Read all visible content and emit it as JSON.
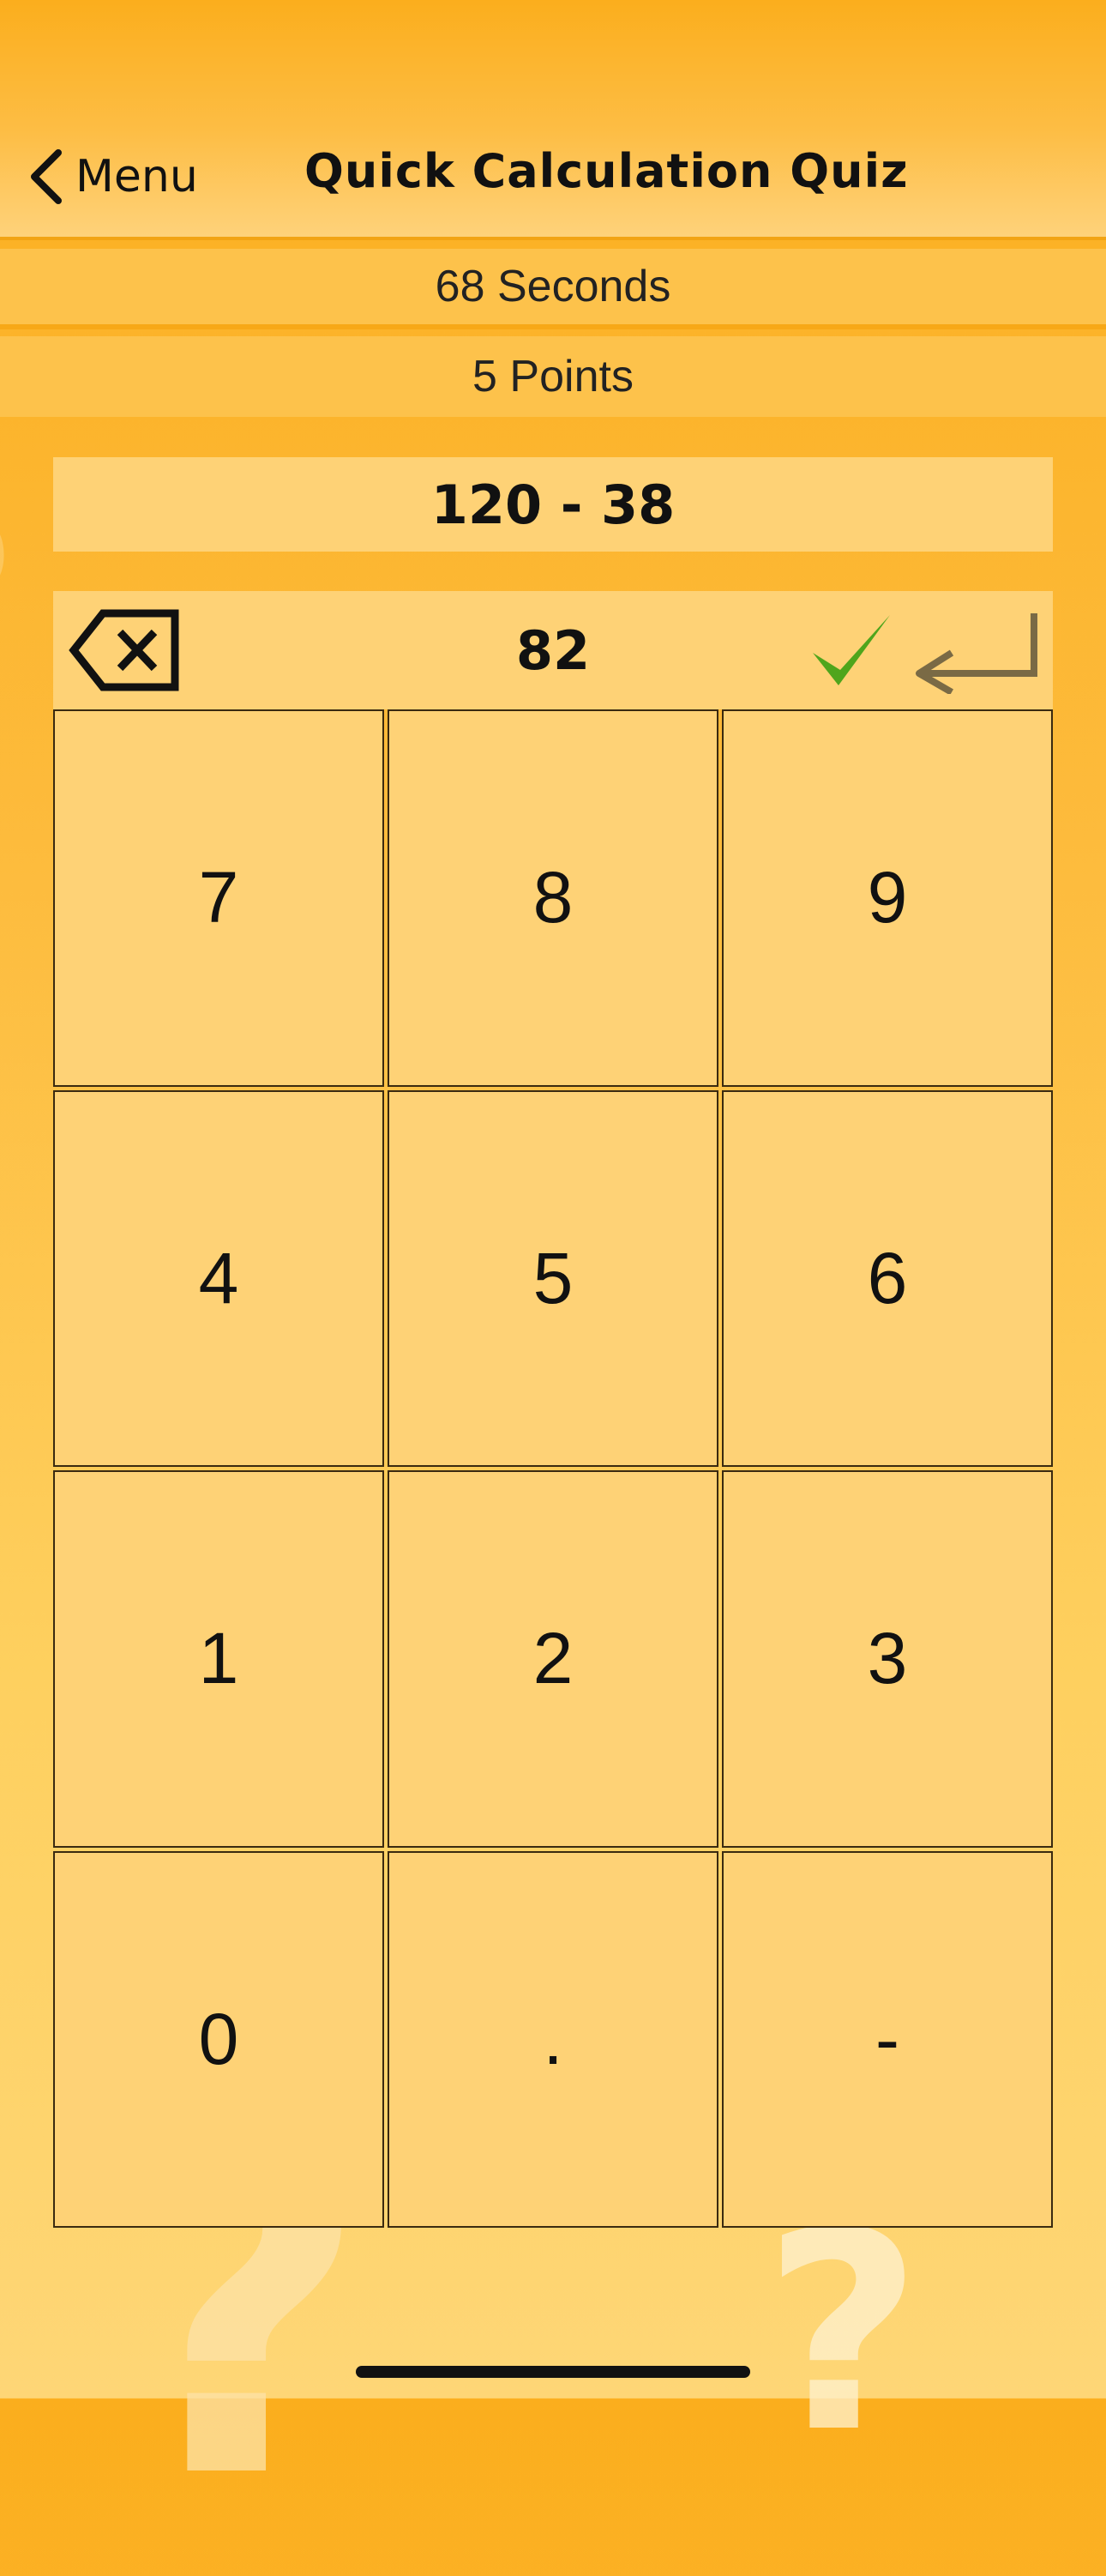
{
  "nav": {
    "back_label": "Menu",
    "title": "Quick Calculation Quiz"
  },
  "status": {
    "timer": "68 Seconds",
    "points": "5 Points"
  },
  "quiz": {
    "question": "120 - 38",
    "answer": "82"
  },
  "keypad": {
    "keys": [
      "7",
      "8",
      "9",
      "4",
      "5",
      "6",
      "1",
      "2",
      "3",
      "0",
      ".",
      "-"
    ]
  },
  "icons": {
    "back": "chevron-left-icon",
    "backspace": "backspace-icon",
    "check": "checkmark-icon",
    "enter": "enter-return-icon"
  },
  "colors": {
    "background_top": "#fbae1d",
    "background_bottom": "#fed676",
    "panel": "#fed276",
    "check": "#4fa51c",
    "enter": "#7a6a45"
  }
}
